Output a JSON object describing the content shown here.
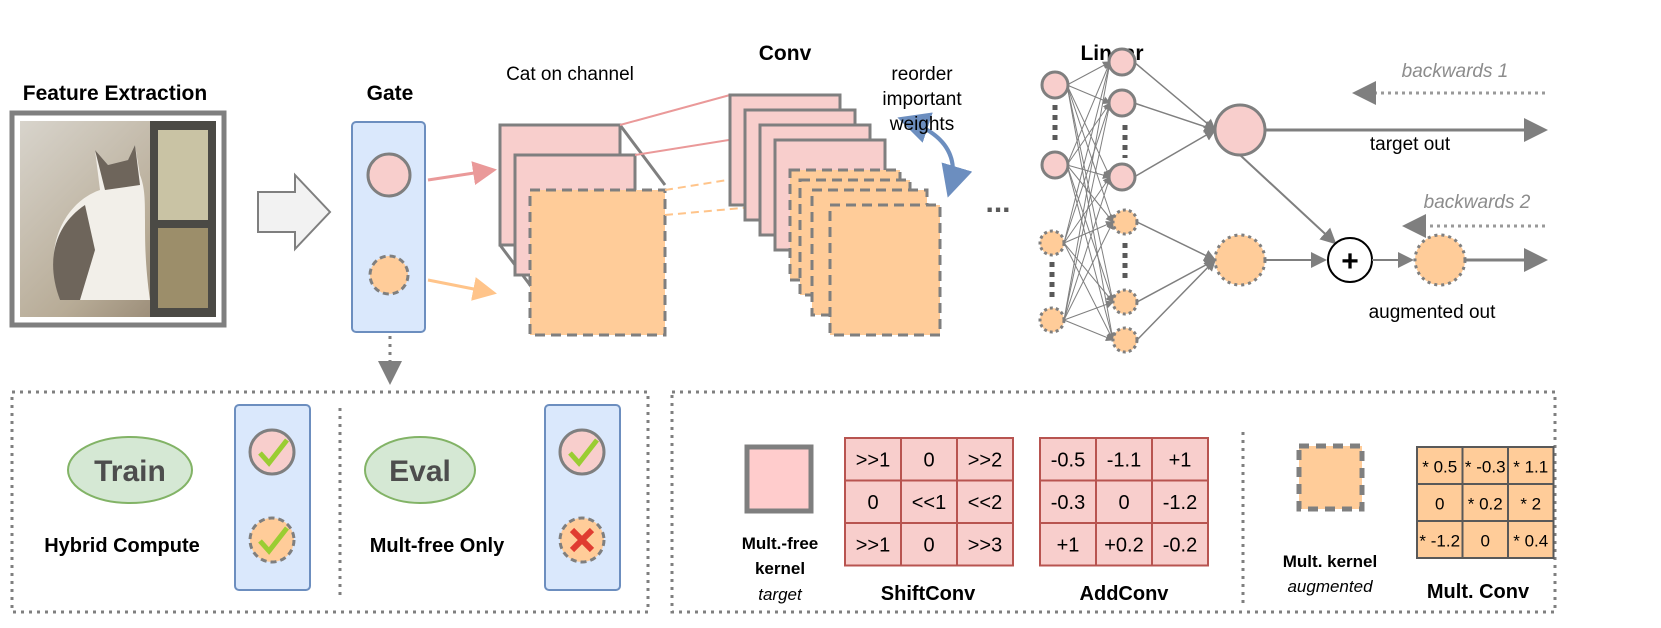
{
  "labels": {
    "feature_extraction": "Feature Extraction",
    "gate": "Gate",
    "cat_on_channel": "Cat on channel",
    "conv": "Conv",
    "reorder": [
      "reorder",
      "important",
      "weights"
    ],
    "ellipsis": "...",
    "linear": "Linear",
    "backwards1": "backwards 1",
    "backwards2": "backwards 2",
    "target_out": "target out",
    "augmented_out": "augmented out",
    "plus": "+"
  },
  "modes": {
    "train": {
      "label": "Train",
      "caption": "Hybrid Compute"
    },
    "eval": {
      "label": "Eval",
      "caption": "Mult-free Only"
    }
  },
  "kernels": {
    "multfree": {
      "line1": "Mult.-free",
      "line2": "kernel",
      "tag": "target"
    },
    "mult": {
      "line1": "Mult. kernel",
      "tag": "augmented"
    }
  },
  "tables": {
    "shiftconv": {
      "title": "ShiftConv",
      "cells": [
        [
          ">>1",
          "0",
          ">>2"
        ],
        [
          "0",
          "<<1",
          "<<2"
        ],
        [
          ">>1",
          "0",
          ">>3"
        ]
      ]
    },
    "addconv": {
      "title": "AddConv",
      "cells": [
        [
          "-0.5",
          "-1.1",
          "+1"
        ],
        [
          "-0.3",
          "0",
          "-1.2"
        ],
        [
          "+1",
          "+0.2",
          "-0.2"
        ]
      ]
    },
    "multconv": {
      "title": "Mult. Conv",
      "cells": [
        [
          "* 0.5",
          "* -0.3",
          "* 1.1"
        ],
        [
          "0",
          "* 0.2",
          "* 2"
        ],
        [
          "* -1.2",
          "0",
          "* 0.4"
        ]
      ]
    }
  },
  "colors": {
    "pink": "#f8cecc",
    "pink_stroke": "#b85450",
    "orange": "#ffcc99",
    "gate_fill": "#dae8fc",
    "gate_stroke": "#6c8ebf",
    "green": "#d5e8d4",
    "green_stroke": "#82b366",
    "gray": "#7f7f7f",
    "blue_arrow": "#6c8ebf"
  }
}
